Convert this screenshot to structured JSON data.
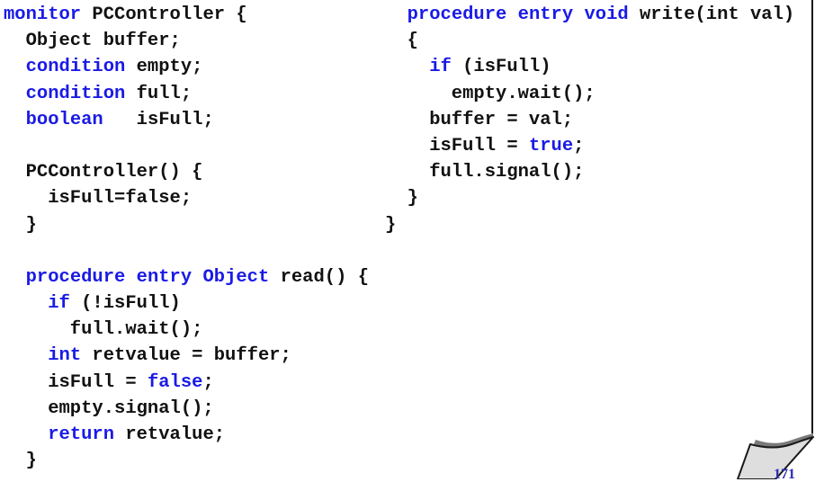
{
  "slide": {
    "page_number": "171",
    "colors": {
      "keyword": "#1a1ae6",
      "text": "#111111",
      "page_number": "#2b2bb0"
    }
  },
  "left_code": [
    [
      {
        "t": "monitor",
        "k": true
      },
      {
        "t": " PCController {",
        "k": false
      }
    ],
    [
      {
        "t": "  Object buffer;",
        "k": false
      }
    ],
    [
      {
        "t": "  ",
        "k": false
      },
      {
        "t": "condition",
        "k": true
      },
      {
        "t": " empty;",
        "k": false
      }
    ],
    [
      {
        "t": "  ",
        "k": false
      },
      {
        "t": "condition",
        "k": true
      },
      {
        "t": " full;",
        "k": false
      }
    ],
    [
      {
        "t": "  ",
        "k": false
      },
      {
        "t": "boolean",
        "k": true
      },
      {
        "t": "   isFull;",
        "k": false
      }
    ],
    [
      {
        "t": "",
        "k": false
      }
    ],
    [
      {
        "t": "  PCController() {",
        "k": false
      }
    ],
    [
      {
        "t": "    isFull=false;",
        "k": false
      }
    ],
    [
      {
        "t": "  }",
        "k": false
      }
    ],
    [
      {
        "t": "",
        "k": false
      }
    ],
    [
      {
        "t": "  ",
        "k": false
      },
      {
        "t": "procedure",
        "k": true
      },
      {
        "t": " ",
        "k": false
      },
      {
        "t": "entry",
        "k": true
      },
      {
        "t": " ",
        "k": false
      },
      {
        "t": "Object",
        "k": true
      },
      {
        "t": " read() {",
        "k": false
      }
    ],
    [
      {
        "t": "    ",
        "k": false
      },
      {
        "t": "if",
        "k": true
      },
      {
        "t": " (!isFull)",
        "k": false
      }
    ],
    [
      {
        "t": "      full.wait();",
        "k": false
      }
    ],
    [
      {
        "t": "    ",
        "k": false
      },
      {
        "t": "int",
        "k": true
      },
      {
        "t": " retvalue = buffer;",
        "k": false
      }
    ],
    [
      {
        "t": "    isFull = ",
        "k": false
      },
      {
        "t": "false",
        "k": true
      },
      {
        "t": ";",
        "k": false
      }
    ],
    [
      {
        "t": "    empty.signal();",
        "k": false
      }
    ],
    [
      {
        "t": "    ",
        "k": false
      },
      {
        "t": "return",
        "k": true
      },
      {
        "t": " retvalue;",
        "k": false
      }
    ],
    [
      {
        "t": "  }",
        "k": false
      }
    ]
  ],
  "right_code": [
    [
      {
        "t": "  ",
        "k": false
      },
      {
        "t": "procedure",
        "k": true
      },
      {
        "t": " ",
        "k": false
      },
      {
        "t": "entry",
        "k": true
      },
      {
        "t": " ",
        "k": false
      },
      {
        "t": "void",
        "k": true
      },
      {
        "t": " write(int val)",
        "k": false
      }
    ],
    [
      {
        "t": "  {",
        "k": false
      }
    ],
    [
      {
        "t": "    ",
        "k": false
      },
      {
        "t": "if",
        "k": true
      },
      {
        "t": " (isFull)",
        "k": false
      }
    ],
    [
      {
        "t": "      empty.wait();",
        "k": false
      }
    ],
    [
      {
        "t": "    buffer = val;",
        "k": false
      }
    ],
    [
      {
        "t": "    isFull = ",
        "k": false
      },
      {
        "t": "true",
        "k": true
      },
      {
        "t": ";",
        "k": false
      }
    ],
    [
      {
        "t": "    full.signal();",
        "k": false
      }
    ],
    [
      {
        "t": "  }",
        "k": false
      }
    ],
    [
      {
        "t": "}",
        "k": false
      }
    ]
  ]
}
